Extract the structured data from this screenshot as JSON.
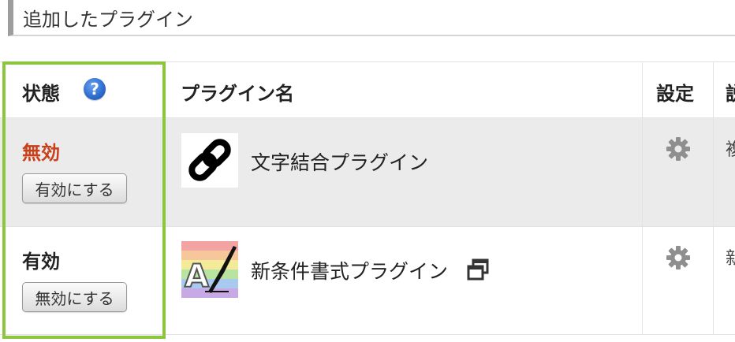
{
  "section": {
    "title": "追加したプラグイン"
  },
  "table": {
    "headers": {
      "status": "状態",
      "plugin_name": "プラグイン名",
      "settings": "設定",
      "description_partial": "説"
    },
    "rows": [
      {
        "status": "無効",
        "action_label": "有効にする",
        "name": "文字結合プラグイン",
        "description_partial": "複",
        "icon": "chain-link-icon"
      },
      {
        "status": "有効",
        "action_label": "無効にする",
        "name": "新条件書式プラグイン",
        "description_partial": "新",
        "icon": "rainbow-pen-icon"
      }
    ]
  },
  "colors": {
    "highlight": "#8cc63e",
    "status_disabled": "#c8401a",
    "disabled_row_bg": "#ebebeb"
  }
}
